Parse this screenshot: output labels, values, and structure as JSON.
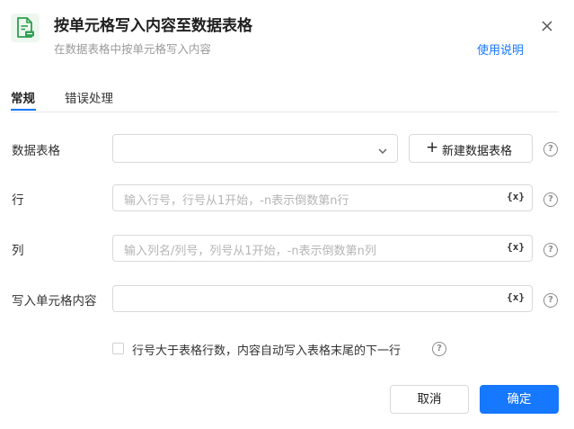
{
  "header": {
    "title": "按单元格写入内容至数据表格",
    "subtitle": "在数据表格中按单元格写入内容",
    "help_link": "使用说明",
    "icon": "spreadsheet-write-icon",
    "close_icon": "close-icon",
    "accent_color": "#1677ff",
    "icon_color": "#2e9e4f"
  },
  "tabs": [
    {
      "label": "常规",
      "active": true
    },
    {
      "label": "错误处理",
      "active": false
    }
  ],
  "form": {
    "table": {
      "label": "数据表格",
      "value": "",
      "new_button": "新建数据表格",
      "new_button_icon": "plus-icon"
    },
    "row": {
      "label": "行",
      "placeholder": "输入行号，行号从1开始，-n表示倒数第n行",
      "value": ""
    },
    "column": {
      "label": "列",
      "placeholder": "输入列名/列号，列号从1开始，-n表示倒数第n列",
      "value": ""
    },
    "content": {
      "label": "写入单元格内容",
      "placeholder": "",
      "value": ""
    },
    "variable_icon_text": "{x}",
    "help_icon_text": "?",
    "auto_append": {
      "label": "行号大于表格行数，内容自动写入表格末尾的下一行",
      "checked": false
    }
  },
  "footer": {
    "cancel": "取消",
    "ok": "确定"
  }
}
